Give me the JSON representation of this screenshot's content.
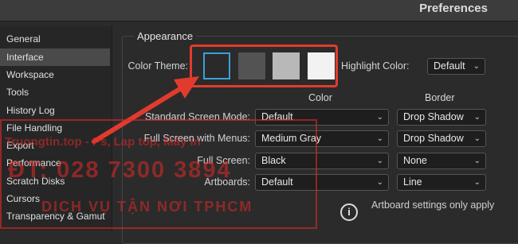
{
  "window": {
    "title": "Preferences"
  },
  "sidebar": {
    "items": [
      {
        "label": "General"
      },
      {
        "label": "Interface",
        "selected": true
      },
      {
        "label": "Workspace"
      },
      {
        "label": "Tools"
      },
      {
        "label": "History Log"
      },
      {
        "label": "File Handling"
      },
      {
        "label": "Export"
      },
      {
        "label": "Performance"
      },
      {
        "label": "Scratch Disks"
      },
      {
        "label": "Cursors"
      },
      {
        "label": "Transparency & Gamut"
      }
    ]
  },
  "appearance": {
    "heading": "Appearance",
    "color_theme_label": "Color Theme:",
    "themes": [
      "#2a2a2a",
      "#535353",
      "#b8b8b8",
      "#f2f2f2"
    ],
    "selected_theme_outline": "#3aa1d8",
    "highlight_label": "Highlight Color:",
    "highlight_value": "Default",
    "col_color": "Color",
    "col_border": "Border",
    "rows": [
      {
        "label": "Standard Screen Mode:",
        "color": "Default",
        "border": "Drop Shadow"
      },
      {
        "label": "Full Screen with Menus:",
        "color": "Medium Gray",
        "border": "Drop Shadow"
      },
      {
        "label": "Full Screen:",
        "color": "Black",
        "border": "None"
      },
      {
        "label": "Artboards:",
        "color": "Default",
        "border": "Line"
      }
    ],
    "info_text": "Artboard settings only apply"
  },
  "annotation": {
    "accent": "#e23b2e"
  },
  "watermark": {
    "line1": "Truongtin.top - Ps, Lap top, Máy in",
    "line2": "ĐT: 028 7300 3894",
    "line3": "DỊCH VỤ TẬN NƠI TPHCM"
  }
}
